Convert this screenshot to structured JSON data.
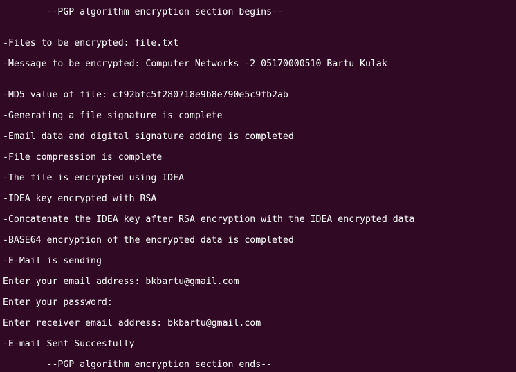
{
  "terminal": {
    "background": "#300a24",
    "foreground": "#ffffff",
    "lines": [
      "        --PGP algorithm encryption section begins--",
      "",
      "-Files to be encrypted: file.txt",
      "-Message to be encrypted: Computer Networks -2 05170000510 Bartu Kulak",
      "",
      "-MD5 value of file: cf92bfc5f280718e9b8e790e5c9fb2ab",
      "-Generating a file signature is complete",
      "-Email data and digital signature adding is completed",
      "-File compression is complete",
      "-The file is encrypted using IDEA",
      "-IDEA key encrypted with RSA",
      "-Concatenate the IDEA key after RSA encryption with the IDEA encrypted data",
      "-BASE64 encryption of the encrypted data is completed",
      "-E-Mail is sending",
      "Enter your email address: bkbartu@gmail.com",
      "Enter your password:",
      "Enter receiver email address: bkbartu@gmail.com",
      "-E-mail Sent Succesfully",
      "        --PGP algorithm encryption section ends--"
    ]
  }
}
